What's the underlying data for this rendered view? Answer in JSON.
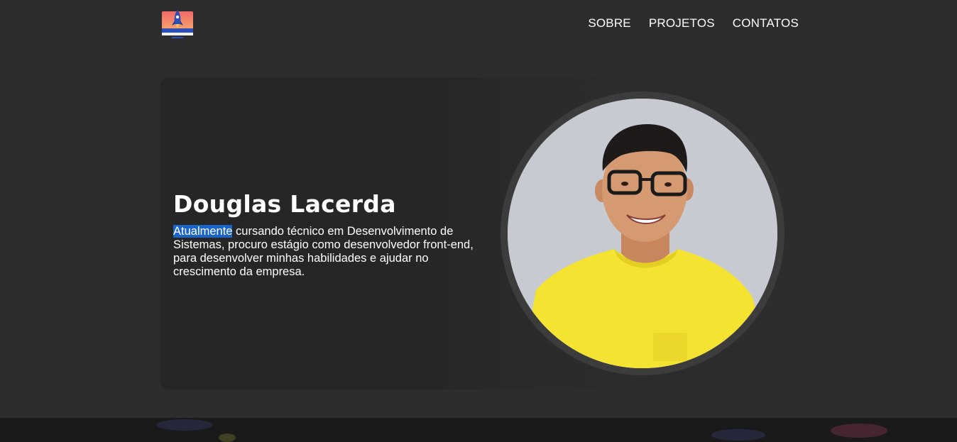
{
  "header": {
    "logo_icon": "rocket-logo-icon",
    "nav": [
      {
        "label": "SOBRE"
      },
      {
        "label": "PROJETOS"
      },
      {
        "label": "CONTATOS"
      }
    ]
  },
  "hero": {
    "name": "Douglas Lacerda",
    "description_selected": "Atualmente",
    "description_rest": " cursando técnico em Desenvolvimento de Sistemas, procuro estágio como desenvolvedor front-end, para desenvolver minhas habilidades e ajudar no crescimento da empresa.",
    "photo_icon": "profile-photo",
    "selection_color": "#1a64c8"
  },
  "colors": {
    "background": "#2d2d2d",
    "card": "#262626",
    "text": "#ffffff",
    "shirt": "#f5e332",
    "photo_background": "#c8cad1"
  }
}
